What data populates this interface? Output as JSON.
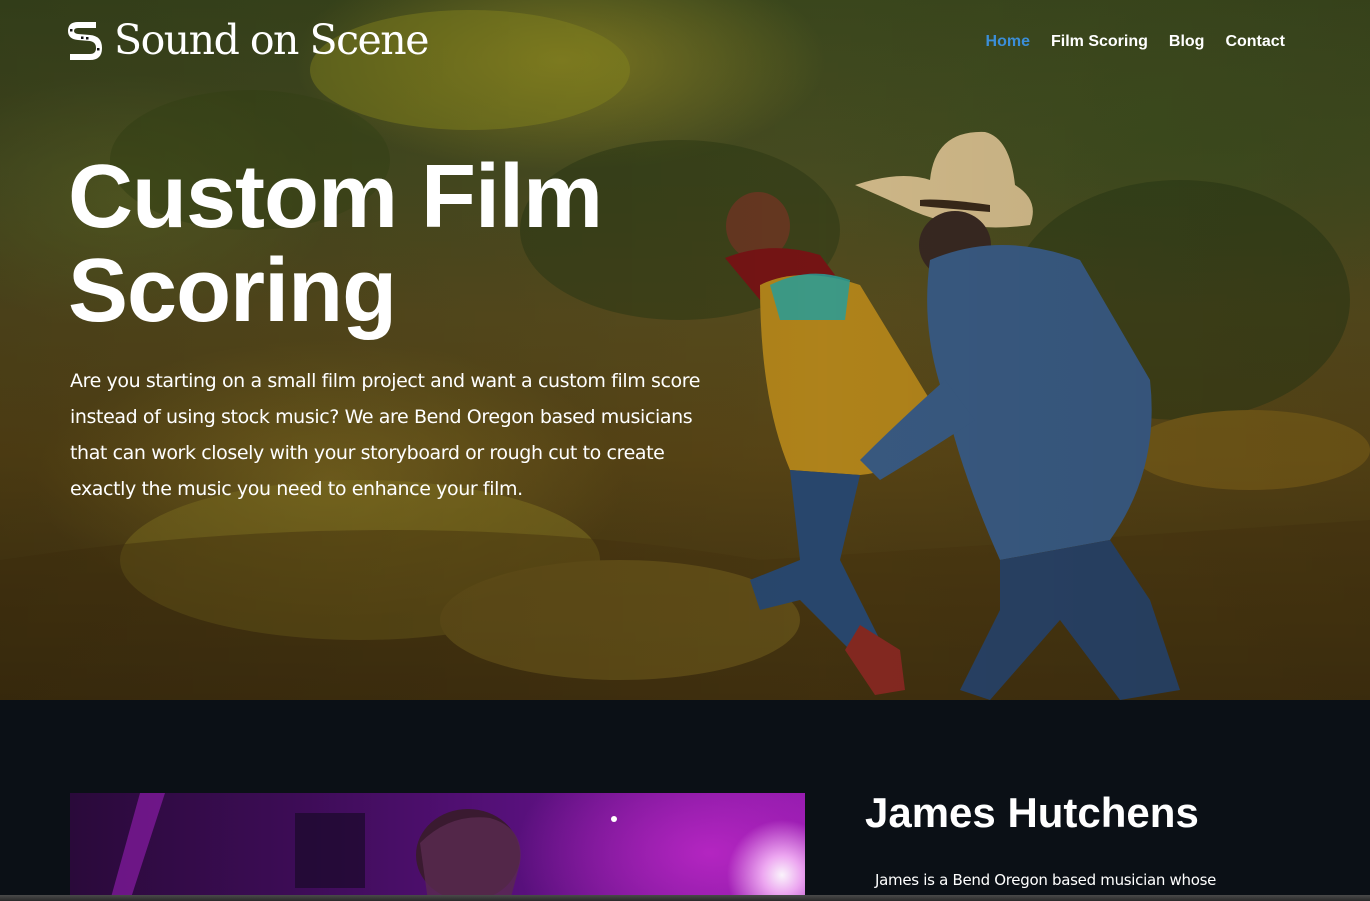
{
  "brand": {
    "name": "Sound on Scene",
    "logo_icon": "film-strip-s-icon"
  },
  "nav": {
    "items": [
      {
        "label": "Home",
        "active": true
      },
      {
        "label": "Film Scoring",
        "active": false
      },
      {
        "label": "Blog",
        "active": false
      },
      {
        "label": "Contact",
        "active": false
      }
    ]
  },
  "hero": {
    "title": "Custom Film Scoring",
    "body": "Are you starting on a small film project and want a custom film score instead of using stock music? We are Bend Oregon based musicians that can work closely with your storyboard or rough cut to create exactly the music you need to enhance your film."
  },
  "about": {
    "name": "James Hutchens",
    "bio": "James is a Bend Oregon based musician whose"
  },
  "colors": {
    "nav_active": "#3b8ed8",
    "dark_section": "#0b1016",
    "text": "#ffffff"
  }
}
